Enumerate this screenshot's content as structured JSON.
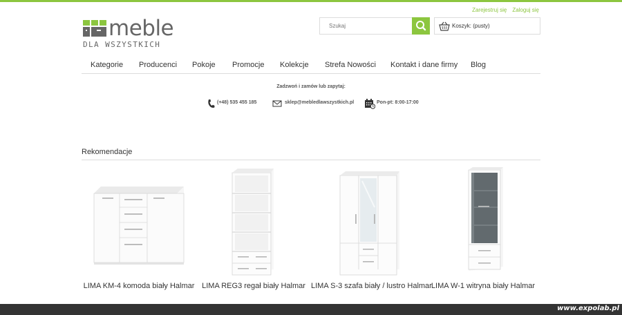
{
  "top_links": {
    "register": "Zarejestruj się",
    "login": "Zaloguj się"
  },
  "logo": {
    "word": "meble",
    "sub": "DLA WSZYSTKICH"
  },
  "search": {
    "placeholder": "Szukaj"
  },
  "cart": {
    "label": "Koszyk:",
    "status": "(pusty)"
  },
  "nav": [
    "Kategorie",
    "Producenci",
    "Pokoje",
    "Promocje",
    "Kolekcje",
    "Strefa Nowości",
    "Kontakt i dane firmy",
    "Blog"
  ],
  "contact": {
    "heading": "Zadzwoń i zamów lub zapytaj:",
    "phone": "(+48) 535 455 185",
    "email": "sklep@mebledlawszystkich.pl",
    "hours": "Pon-pt: 8:00-17:00"
  },
  "recommendations": {
    "title": "Rekomendacje",
    "products": [
      {
        "name": "LIMA KM-4 komoda biały Halmar"
      },
      {
        "name": "LIMA REG3 regał biały Halmar"
      },
      {
        "name": "LIMA S-3 szafa biały / lustro Halmar"
      },
      {
        "name": "LIMA W-1 witryna biały Halmar"
      }
    ]
  },
  "footer": {
    "watermark": "www.expolab.pl"
  },
  "colors": {
    "accent": "#8cc63f",
    "footer": "#333333",
    "border": "#dcdcdc"
  }
}
